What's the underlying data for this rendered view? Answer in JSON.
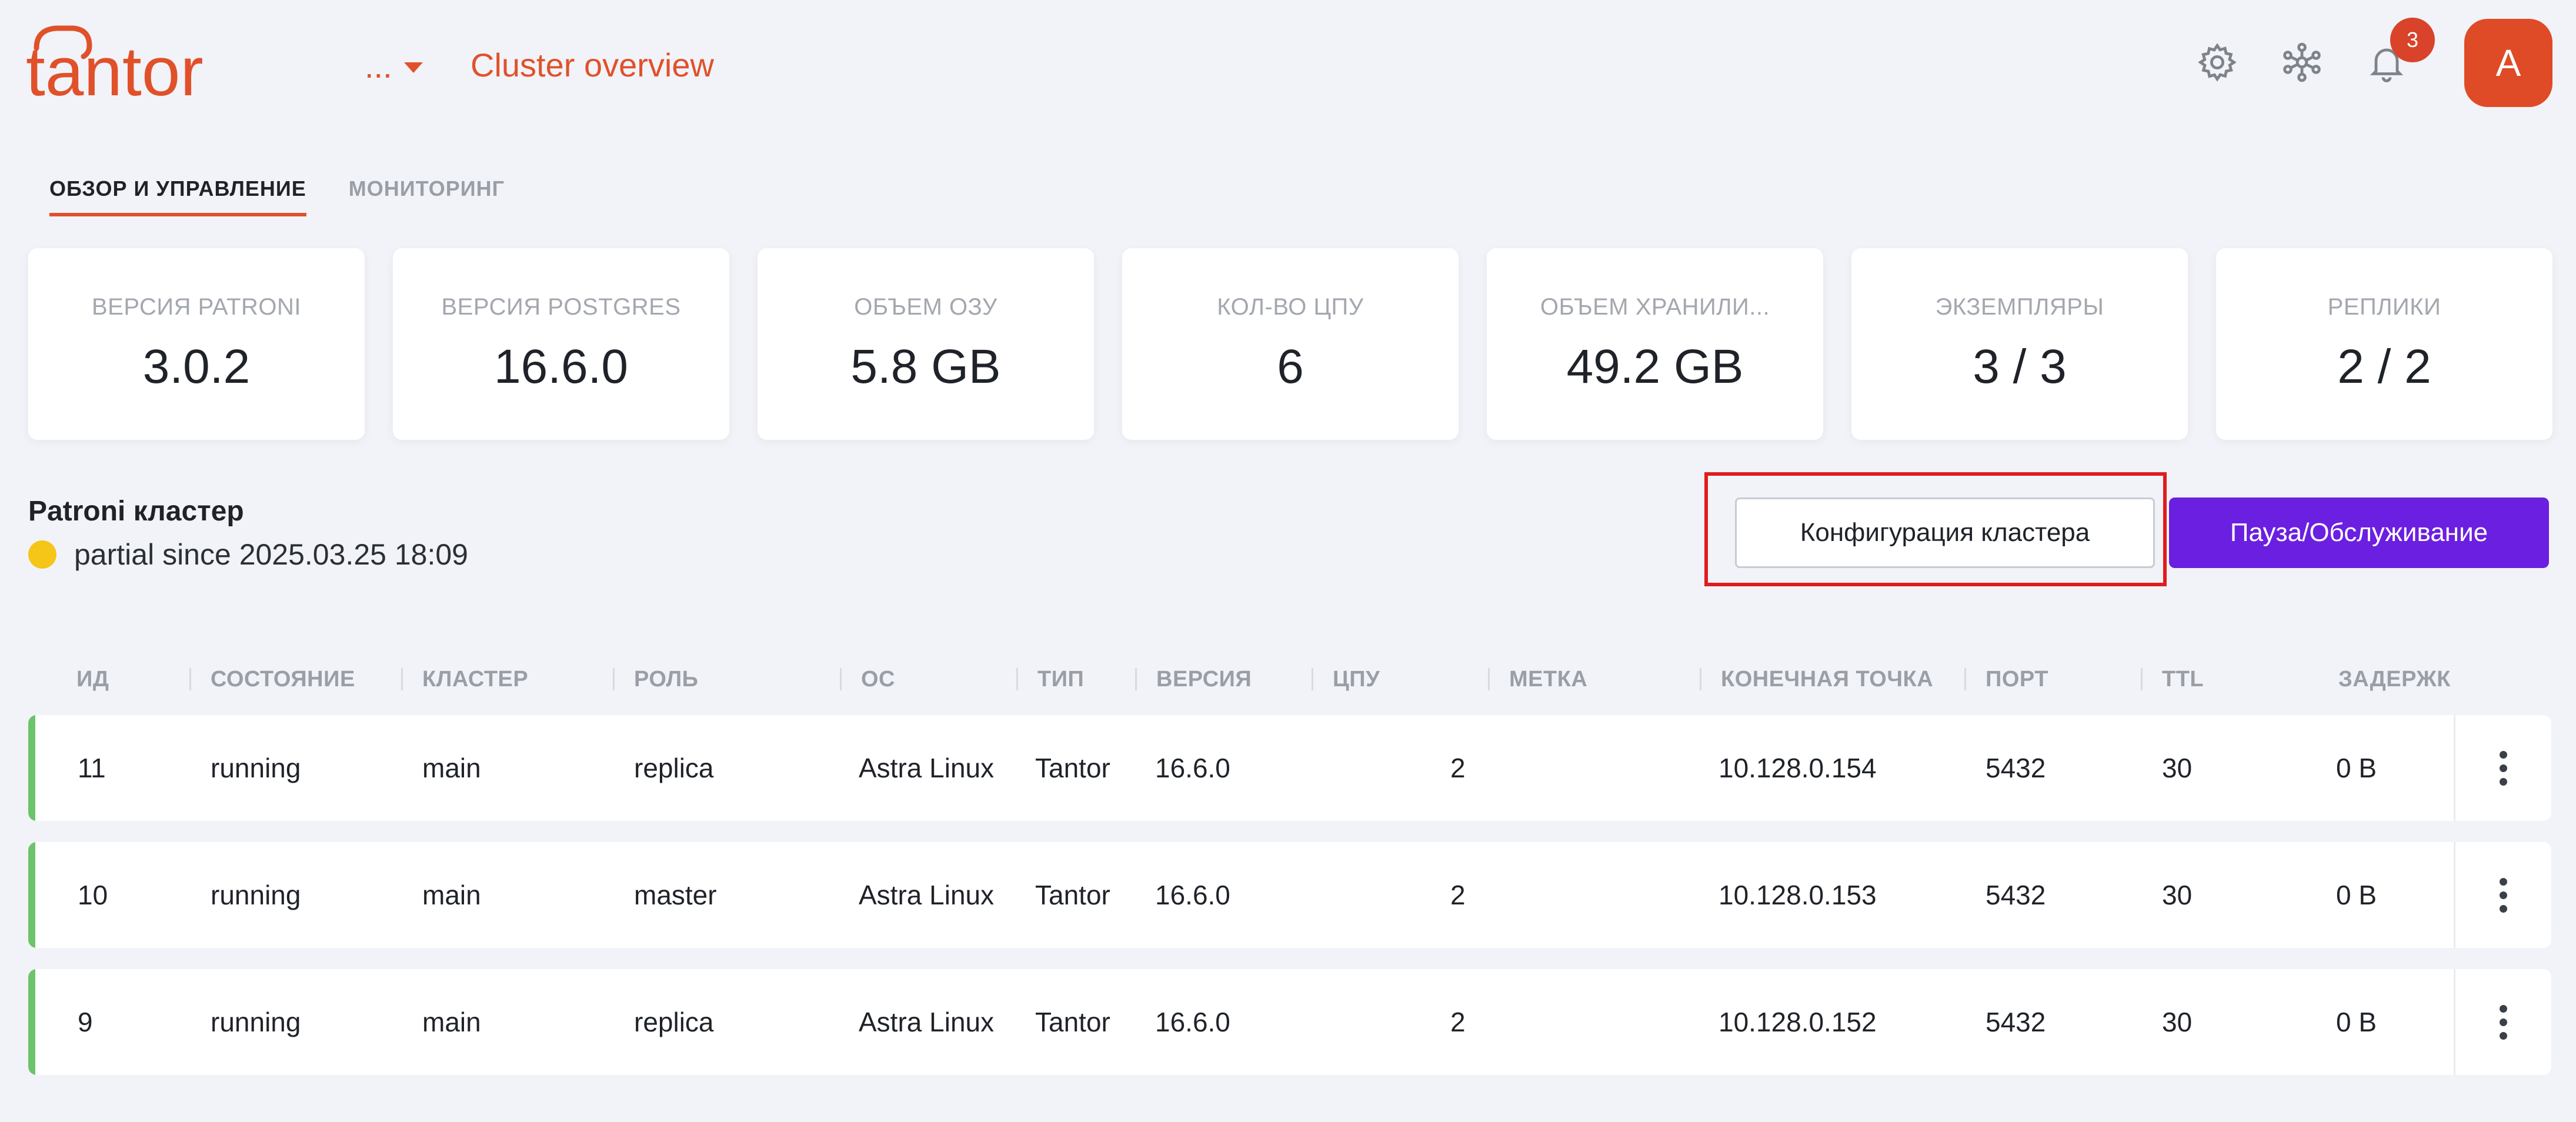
{
  "header": {
    "logo_text": "tantor",
    "context_menu_label": "...",
    "page_title": "Cluster overview",
    "notifications_count": "3",
    "avatar_initial": "A",
    "icons": [
      "settings-icon",
      "network-icon",
      "bell-icon"
    ],
    "accent_color": "#e0512a"
  },
  "tabs": [
    {
      "label": "ОБЗОР И УПРАВЛЕНИЕ",
      "active": true
    },
    {
      "label": "МОНИТОРИНГ",
      "active": false
    }
  ],
  "stats": [
    {
      "label": "ВЕРСИЯ PATRONI",
      "value": "3.0.2"
    },
    {
      "label": "ВЕРСИЯ POSTGRES",
      "value": "16.6.0"
    },
    {
      "label": "ОБЪЕМ ОЗУ",
      "value": "5.8 GB"
    },
    {
      "label": "КОЛ-ВО ЦПУ",
      "value": "6"
    },
    {
      "label": "ОБЪЕМ ХРАНИЛИ...",
      "value": "49.2 GB"
    },
    {
      "label": "ЭКЗЕМПЛЯРЫ",
      "value": "3 / 3"
    },
    {
      "label": "РЕПЛИКИ",
      "value": "2 / 2"
    }
  ],
  "cluster": {
    "title": "Patroni кластер",
    "status_text": "partial since 2025.03.25 18:09",
    "status_color": "#f5c518",
    "config_button": "Конфигурация кластера",
    "pause_button": "Пауза/Обслуживание",
    "pause_button_color": "#6b1fe0"
  },
  "table": {
    "columns": [
      "ИД",
      "СОСТОЯНИЕ",
      "КЛАСТЕР",
      "РОЛЬ",
      "ОС",
      "ТИП",
      "ВЕРСИЯ",
      "ЦПУ",
      "МЕТКА",
      "КОНЕЧНАЯ ТОЧКА",
      "ПОРТ",
      "TTL",
      "ЗАДЕРЖК"
    ],
    "rows": [
      {
        "id": "11",
        "state": "running",
        "cluster": "main",
        "role": "replica",
        "os": "Astra Linux",
        "type": "Tantor",
        "version": "16.6.0",
        "cpu": "2",
        "label": "",
        "endpoint": "10.128.0.154",
        "port": "5432",
        "ttl": "30",
        "lag": "0 B"
      },
      {
        "id": "10",
        "state": "running",
        "cluster": "main",
        "role": "master",
        "os": "Astra Linux",
        "type": "Tantor",
        "version": "16.6.0",
        "cpu": "2",
        "label": "",
        "endpoint": "10.128.0.153",
        "port": "5432",
        "ttl": "30",
        "lag": "0 B"
      },
      {
        "id": "9",
        "state": "running",
        "cluster": "main",
        "role": "replica",
        "os": "Astra Linux",
        "type": "Tantor",
        "version": "16.6.0",
        "cpu": "2",
        "label": "",
        "endpoint": "10.128.0.152",
        "port": "5432",
        "ttl": "30",
        "lag": "0 B"
      }
    ],
    "row_status_color": "#6cc36a"
  }
}
